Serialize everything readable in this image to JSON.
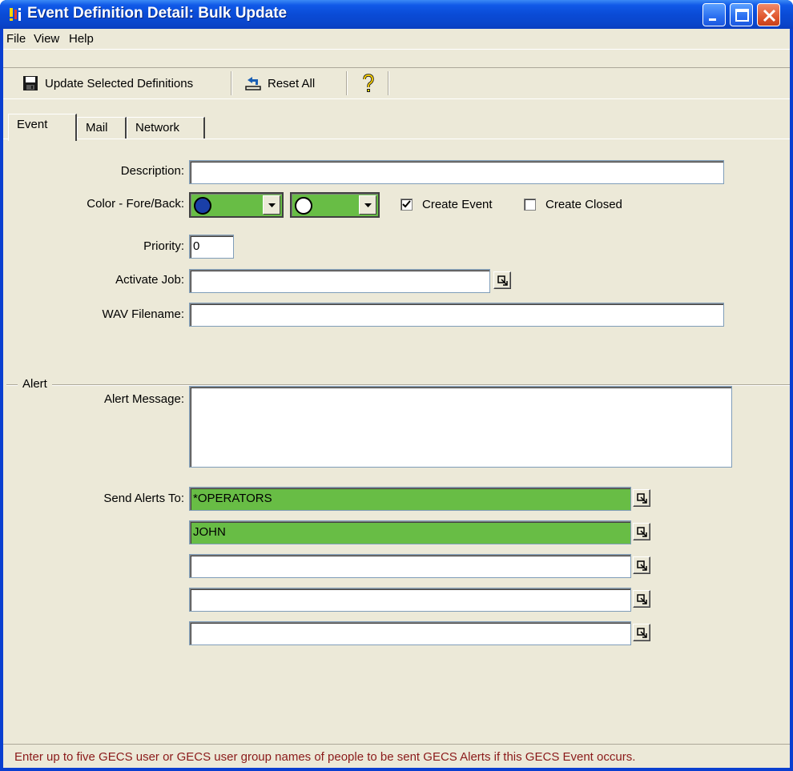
{
  "window": {
    "title": "Event Definition Detail: Bulk Update",
    "app_icon": "gecs-app-icon"
  },
  "menu": {
    "file": "File",
    "view": "View",
    "help": "Help"
  },
  "toolbar": {
    "update_label": "Update Selected Definitions",
    "update_icon": "floppy-disk-icon",
    "reset_label": "Reset All",
    "reset_icon": "reset-icon",
    "help_icon": "question-mark-icon"
  },
  "tabs": [
    {
      "label": "Event",
      "active": true
    },
    {
      "label": "Mail",
      "active": false
    },
    {
      "label": "Network",
      "active": false
    }
  ],
  "form": {
    "description_label": "Description:",
    "description_value": "",
    "color_label": "Color - Fore/Back:",
    "fore_color": "#1a3fa8",
    "back_color": "#ffffff",
    "combo_fill": "#68bd45",
    "create_event_label": "Create Event",
    "create_event_checked": true,
    "create_closed_label": "Create Closed",
    "create_closed_checked": false,
    "priority_label": "Priority:",
    "priority_value": "0",
    "activate_job_label": "Activate Job:",
    "activate_job_value": "",
    "wav_label": "WAV Filename:",
    "wav_value": ""
  },
  "alert": {
    "group_label": "Alert",
    "message_label": "Alert Message:",
    "message_value": "",
    "send_to_label": "Send Alerts To:",
    "recipients": [
      "*OPERATORS",
      "JOHN",
      "",
      "",
      ""
    ]
  },
  "status": {
    "message": "Enter up to five GECS user or GECS user group names of people to be sent GECS Alerts if this GECS Event occurs."
  }
}
